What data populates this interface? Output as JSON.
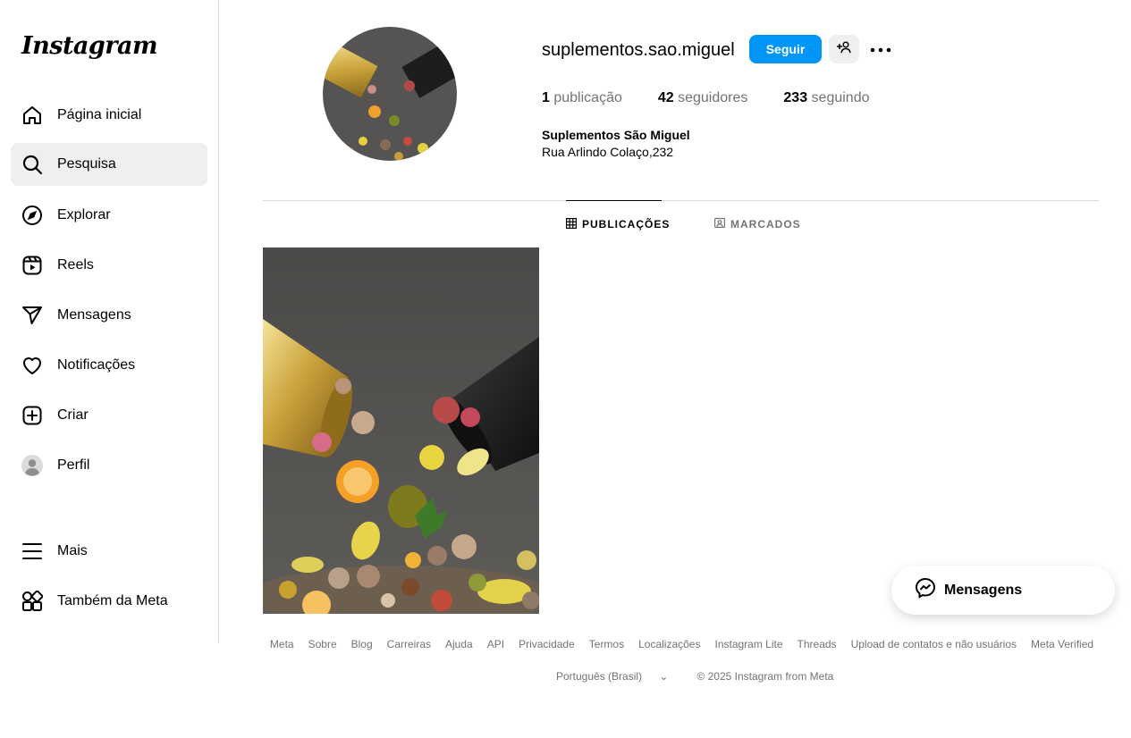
{
  "brand": {
    "logo_text": "Instagram"
  },
  "sidebar": {
    "items": [
      {
        "label": "Página inicial",
        "icon": "home-icon"
      },
      {
        "label": "Pesquisa",
        "icon": "search-icon",
        "active": true
      },
      {
        "label": "Explorar",
        "icon": "compass-icon"
      },
      {
        "label": "Reels",
        "icon": "reels-icon"
      },
      {
        "label": "Mensagens",
        "icon": "send-icon"
      },
      {
        "label": "Notificações",
        "icon": "heart-icon"
      },
      {
        "label": "Criar",
        "icon": "plus-square-icon"
      },
      {
        "label": "Perfil",
        "icon": "avatar-icon"
      },
      {
        "label": "Mais",
        "icon": "menu-icon"
      },
      {
        "label": "Também da Meta",
        "icon": "meta-apps-icon"
      }
    ]
  },
  "profile": {
    "username": "suplementos.sao.miguel",
    "follow_label": "Seguir",
    "stats": {
      "posts_count": "1",
      "posts_label": "publicação",
      "followers_count": "42",
      "followers_label": "seguidores",
      "following_count": "233",
      "following_label": "seguindo"
    },
    "full_name": "Suplementos São Miguel",
    "bio": "Rua Arlindo Colaço,232"
  },
  "tabs": [
    {
      "label": "PUBLICAÇÕES",
      "active": true,
      "icon": "grid-icon"
    },
    {
      "label": "MARCADOS",
      "active": false,
      "icon": "tagged-icon"
    }
  ],
  "footer": {
    "links": [
      "Meta",
      "Sobre",
      "Blog",
      "Carreiras",
      "Ajuda",
      "API",
      "Privacidade",
      "Termos",
      "Localizações",
      "Instagram Lite",
      "Threads",
      "Upload de contatos e não usuários",
      "Meta Verified"
    ],
    "language": "Português (Brasil)",
    "copyright": "© 2025 Instagram from Meta"
  },
  "messages_float": {
    "label": "Mensagens"
  },
  "colors": {
    "accent": "#0095f6",
    "muted": "#737373",
    "border": "#dbdbdb",
    "active_bg": "#efefef"
  }
}
